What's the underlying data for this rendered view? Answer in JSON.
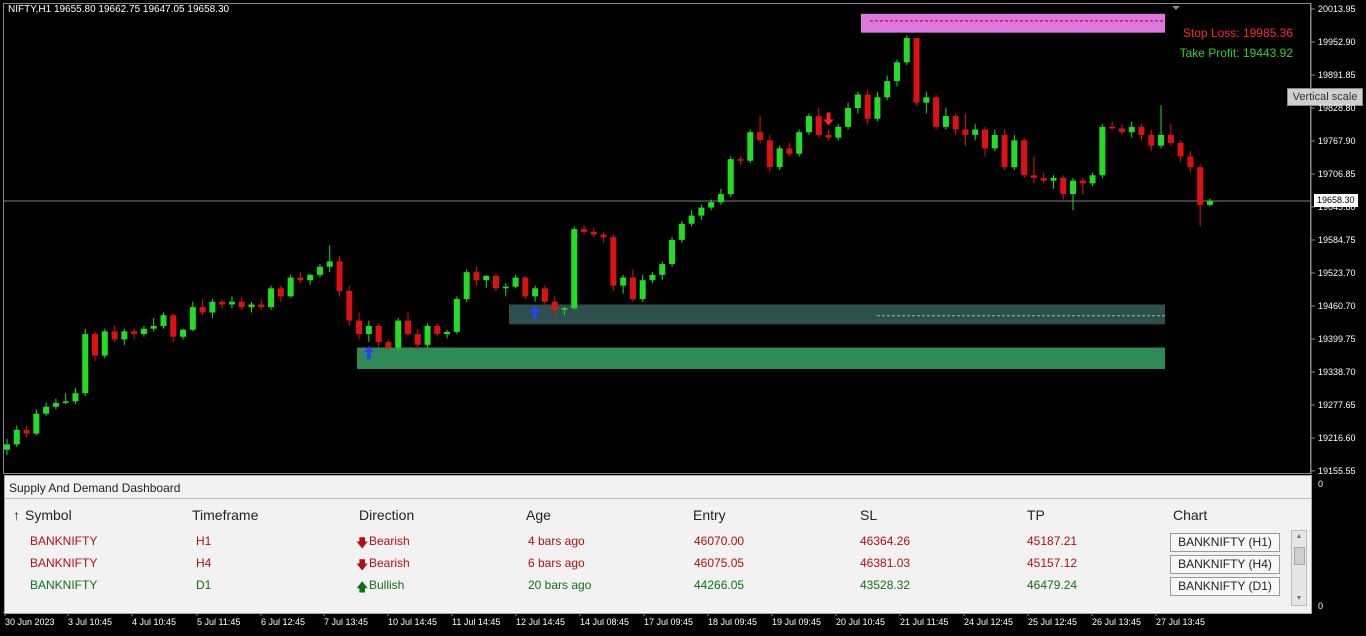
{
  "chart": {
    "symbol_info": "NIFTY,H1  19655.80 19662.75 19647.05 19658.30",
    "stop_loss_label": "Stop Loss: 19985.36",
    "take_profit_label": "Take Profit: 19443.92",
    "current_price": "19658.30",
    "tooltip": "Vertical scale",
    "zero_label": "0",
    "price_levels": [
      "20013.95",
      "19952.90",
      "19891.85",
      "19828.80",
      "19767.90",
      "19706.85",
      "19645.80",
      "19584.75",
      "19523.70",
      "19460.70",
      "19399.75",
      "19338.70",
      "19277.65",
      "19216.60",
      "19155.55"
    ],
    "time_labels": [
      "30 Jun 2023",
      "3 Jul 10:45",
      "4 Jul 10:45",
      "5 Jul 11:45",
      "6 Jul 12:45",
      "7 Jul 13:45",
      "10 Jul 14:45",
      "11 Jul 14:45",
      "12 Jul 14:45",
      "14 Jul 08:45",
      "17 Jul 09:45",
      "18 Jul 09:45",
      "19 Jul 09:45",
      "20 Jul 10:45",
      "21 Jul 11:45",
      "24 Jul 12:45",
      "25 Jul 12:45",
      "26 Jul 13:45",
      "27 Jul 13:45"
    ],
    "colors": {
      "bull": "#22dd22",
      "bear": "#dd1111",
      "supply_zone": "#dd77dd",
      "demand_zone_1": "#2e8b57",
      "demand_zone_2": "#2f4f4f"
    }
  },
  "dashboard": {
    "title": "Supply And Demand Dashboard",
    "sort_icon": "↑",
    "columns": [
      "Symbol",
      "Timeframe",
      "Direction",
      "Age",
      "Entry",
      "SL",
      "TP",
      "Chart"
    ],
    "rows": [
      {
        "symbol": "BANKNIFTY",
        "timeframe": "H1",
        "arrow": "🡇",
        "direction": "Bearish",
        "age": "4 bars ago",
        "entry": "46070.00",
        "sl": "46364.26",
        "tp": "45187.21",
        "chart": "BANKNIFTY (H1)"
      },
      {
        "symbol": "BANKNIFTY",
        "timeframe": "H4",
        "arrow": "🡇",
        "direction": "Bearish",
        "age": "6 bars ago",
        "entry": "46075.05",
        "sl": "46381.03",
        "tp": "45157.12",
        "chart": "BANKNIFTY (H4)"
      },
      {
        "symbol": "BANKNIFTY",
        "timeframe": "D1",
        "arrow": "🡅",
        "direction": "Bullish",
        "age": "20 bars ago",
        "entry": "44266.05",
        "sl": "43528.32",
        "tp": "46479.24",
        "chart": "BANKNIFTY (D1)"
      }
    ]
  },
  "chart_data": {
    "type": "candlestick",
    "candles": [
      [
        19195,
        19215,
        19185,
        19205
      ],
      [
        19205,
        19240,
        19200,
        19232
      ],
      [
        19232,
        19240,
        19218,
        19225
      ],
      [
        19225,
        19270,
        19222,
        19262
      ],
      [
        19262,
        19283,
        19258,
        19275
      ],
      [
        19275,
        19290,
        19270,
        19282
      ],
      [
        19282,
        19300,
        19280,
        19285
      ],
      [
        19285,
        19310,
        19280,
        19300
      ],
      [
        19300,
        19420,
        19295,
        19410
      ],
      [
        19410,
        19415,
        19360,
        19370
      ],
      [
        19370,
        19420,
        19365,
        19415
      ],
      [
        19415,
        19425,
        19395,
        19400
      ],
      [
        19400,
        19420,
        19390,
        19415
      ],
      [
        19415,
        19420,
        19400,
        19410
      ],
      [
        19410,
        19425,
        19405,
        19420
      ],
      [
        19420,
        19440,
        19415,
        19425
      ],
      [
        19425,
        19450,
        19420,
        19445
      ],
      [
        19445,
        19448,
        19395,
        19405
      ],
      [
        19405,
        19420,
        19400,
        19418
      ],
      [
        19418,
        19470,
        19415,
        19460
      ],
      [
        19460,
        19475,
        19445,
        19450
      ],
      [
        19450,
        19475,
        19440,
        19470
      ],
      [
        19470,
        19475,
        19458,
        19465
      ],
      [
        19465,
        19480,
        19458,
        19470
      ],
      [
        19470,
        19480,
        19455,
        19460
      ],
      [
        19460,
        19470,
        19450,
        19465
      ],
      [
        19465,
        19475,
        19455,
        19460
      ],
      [
        19460,
        19500,
        19455,
        19495
      ],
      [
        19495,
        19500,
        19470,
        19480
      ],
      [
        19480,
        19520,
        19478,
        19515
      ],
      [
        19515,
        19525,
        19505,
        19510
      ],
      [
        19510,
        19522,
        19502,
        19520
      ],
      [
        19520,
        19540,
        19515,
        19535
      ],
      [
        19535,
        19575,
        19525,
        19545
      ],
      [
        19545,
        19555,
        19480,
        19490
      ],
      [
        19490,
        19500,
        19425,
        19435
      ],
      [
        19435,
        19450,
        19400,
        19410
      ],
      [
        19410,
        19435,
        19395,
        19425
      ],
      [
        19425,
        19430,
        19385,
        19395
      ],
      [
        19395,
        19400,
        19380,
        19385
      ],
      [
        19385,
        19440,
        19380,
        19435
      ],
      [
        19435,
        19450,
        19405,
        19410
      ],
      [
        19410,
        19420,
        19380,
        19390
      ],
      [
        19390,
        19430,
        19385,
        19425
      ],
      [
        19425,
        19430,
        19405,
        19410
      ],
      [
        19410,
        19418,
        19402,
        19414
      ],
      [
        19414,
        19480,
        19410,
        19475
      ],
      [
        19475,
        19530,
        19470,
        19525
      ],
      [
        19525,
        19535,
        19500,
        19510
      ],
      [
        19510,
        19520,
        19495,
        19518
      ],
      [
        19518,
        19522,
        19490,
        19495
      ],
      [
        19495,
        19505,
        19480,
        19498
      ],
      [
        19498,
        19520,
        19495,
        19515
      ],
      [
        19515,
        19518,
        19475,
        19480
      ],
      [
        19480,
        19500,
        19470,
        19495
      ],
      [
        19495,
        19500,
        19465,
        19470
      ],
      [
        19470,
        19480,
        19445,
        19455
      ],
      [
        19455,
        19460,
        19445,
        19458
      ],
      [
        19458,
        19610,
        19455,
        19605
      ],
      [
        19605,
        19612,
        19595,
        19600
      ],
      [
        19600,
        19608,
        19590,
        19595
      ],
      [
        19595,
        19600,
        19580,
        19590
      ],
      [
        19590,
        19595,
        19490,
        19500
      ],
      [
        19500,
        19520,
        19485,
        19515
      ],
      [
        19515,
        19530,
        19470,
        19475
      ],
      [
        19475,
        19520,
        19470,
        19510
      ],
      [
        19510,
        19525,
        19505,
        19520
      ],
      [
        19520,
        19545,
        19510,
        19540
      ],
      [
        19540,
        19590,
        19535,
        19585
      ],
      [
        19585,
        19620,
        19580,
        19615
      ],
      [
        19615,
        19640,
        19610,
        19630
      ],
      [
        19630,
        19650,
        19622,
        19645
      ],
      [
        19645,
        19660,
        19640,
        19655
      ],
      [
        19655,
        19680,
        19650,
        19670
      ],
      [
        19670,
        19740,
        19665,
        19735
      ],
      [
        19735,
        19740,
        19725,
        19732
      ],
      [
        19732,
        19790,
        19728,
        19785
      ],
      [
        19785,
        19815,
        19765,
        19770
      ],
      [
        19770,
        19780,
        19710,
        19720
      ],
      [
        19720,
        19760,
        19715,
        19755
      ],
      [
        19755,
        19765,
        19740,
        19745
      ],
      [
        19745,
        19790,
        19740,
        19785
      ],
      [
        19785,
        19820,
        19780,
        19815
      ],
      [
        19815,
        19830,
        19775,
        19780
      ],
      [
        19780,
        19790,
        19770,
        19775
      ],
      [
        19775,
        19800,
        19770,
        19795
      ],
      [
        19795,
        19840,
        19790,
        19830
      ],
      [
        19830,
        19860,
        19820,
        19855
      ],
      [
        19855,
        19865,
        19800,
        19810
      ],
      [
        19810,
        19860,
        19805,
        19850
      ],
      [
        19850,
        19890,
        19845,
        19880
      ],
      [
        19880,
        19920,
        19870,
        19915
      ],
      [
        19915,
        19965,
        19910,
        19960
      ],
      [
        19960,
        19920,
        19835,
        19840
      ],
      [
        19840,
        19860,
        19820,
        19850
      ],
      [
        19850,
        19855,
        19790,
        19795
      ],
      [
        19795,
        19830,
        19790,
        19815
      ],
      [
        19815,
        19820,
        19780,
        19790
      ],
      [
        19790,
        19820,
        19760,
        19780
      ],
      [
        19780,
        19800,
        19770,
        19790
      ],
      [
        19790,
        19795,
        19740,
        19755
      ],
      [
        19755,
        19790,
        19750,
        19780
      ],
      [
        19780,
        19790,
        19715,
        19720
      ],
      [
        19720,
        19780,
        19715,
        19770
      ],
      [
        19770,
        19775,
        19700,
        19705
      ],
      [
        19705,
        19740,
        19690,
        19700
      ],
      [
        19700,
        19710,
        19690,
        19695
      ],
      [
        19695,
        19705,
        19680,
        19700
      ],
      [
        19700,
        19705,
        19660,
        19670
      ],
      [
        19670,
        19700,
        19640,
        19695
      ],
      [
        19695,
        19700,
        19670,
        19690
      ],
      [
        19690,
        19710,
        19685,
        19705
      ],
      [
        19705,
        19800,
        19700,
        19795
      ],
      [
        19795,
        19805,
        19790,
        19792
      ],
      [
        19792,
        19800,
        19780,
        19785
      ],
      [
        19785,
        19805,
        19775,
        19795
      ],
      [
        19795,
        19800,
        19770,
        19780
      ],
      [
        19780,
        19790,
        19750,
        19760
      ],
      [
        19760,
        19835,
        19755,
        19780
      ],
      [
        19780,
        19800,
        19760,
        19765
      ],
      [
        19765,
        19770,
        19730,
        19740
      ],
      [
        19740,
        19750,
        19710,
        19720
      ],
      [
        19720,
        19725,
        19610,
        19650
      ],
      [
        19650,
        19662,
        19647,
        19658
      ]
    ],
    "zones": [
      {
        "type": "supply",
        "low": 19970,
        "high": 20005
      },
      {
        "type": "demand",
        "low": 19428,
        "high": 19465
      },
      {
        "type": "demand",
        "low": 19345,
        "high": 19385
      }
    ],
    "signals": [
      {
        "type": "buy",
        "index": 37
      },
      {
        "type": "buy",
        "index": 54
      },
      {
        "type": "sell",
        "index": 84
      }
    ]
  }
}
